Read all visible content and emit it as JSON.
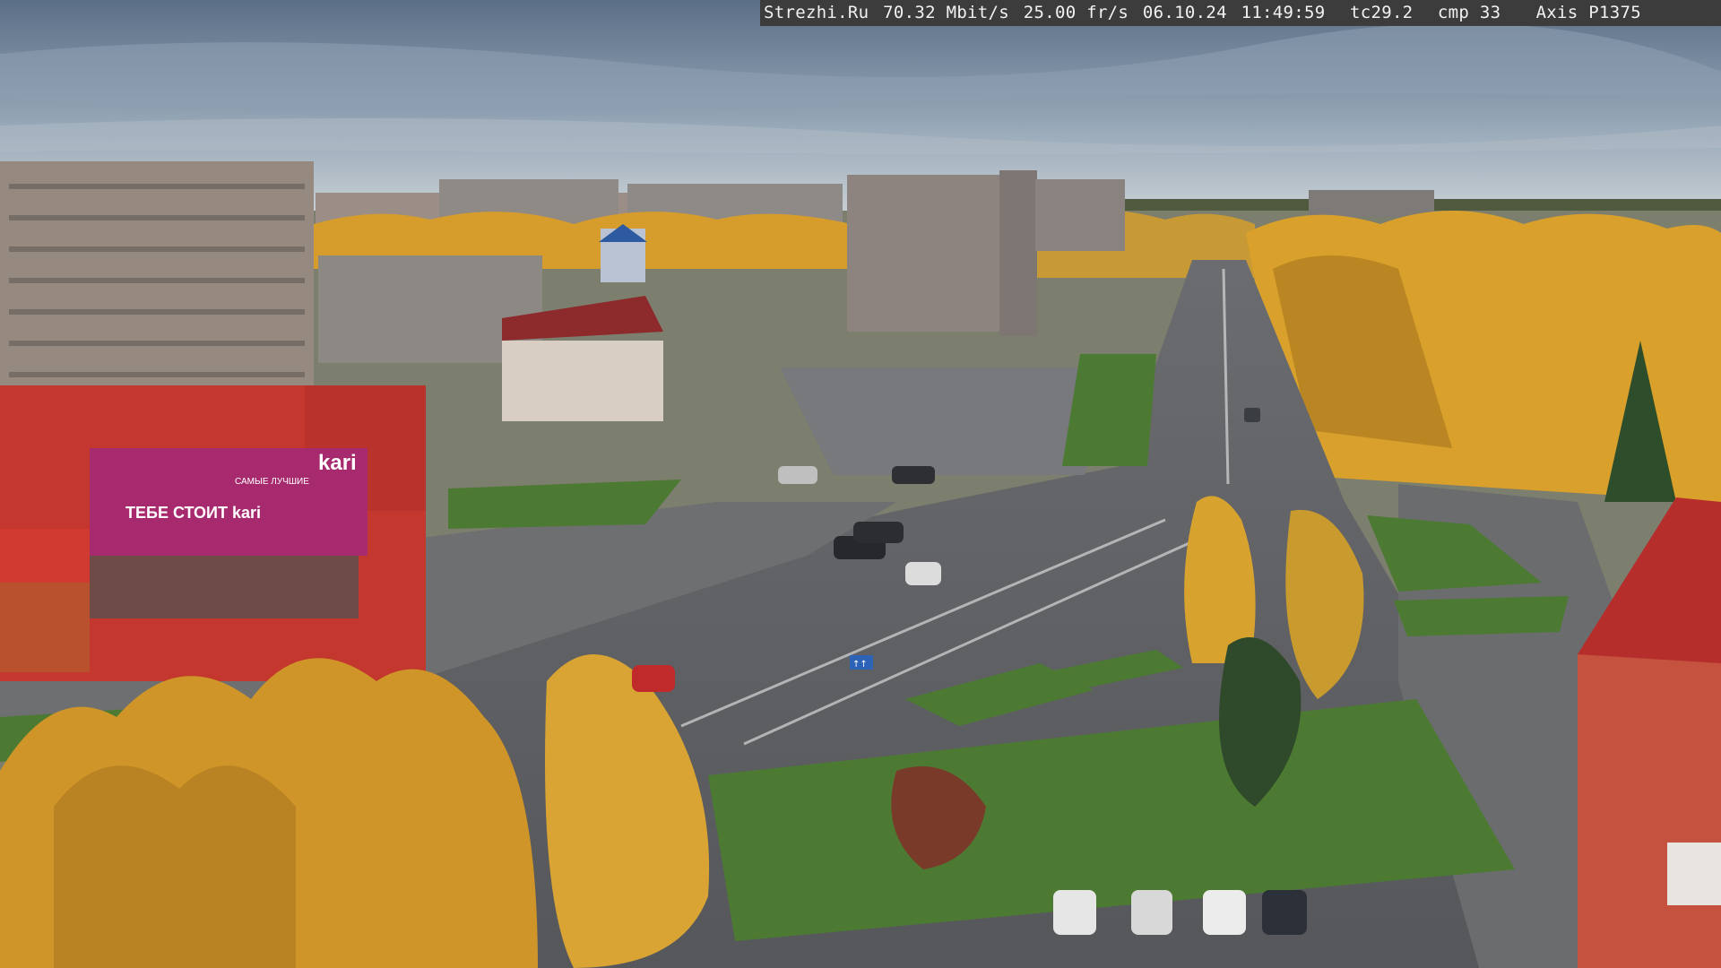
{
  "overlay": {
    "site": "Strezhi.Ru",
    "bitrate": "70.32 Mbit/s",
    "framerate": "25.00 fr/s",
    "date": "06.10.24",
    "time": "11:49:59",
    "tc": "tc29.2",
    "cmp": "cmp 33",
    "camera": "Axis P1375"
  },
  "signage": {
    "store_logo": "kari",
    "store_sign": "ТЕБЕ СТОИТ kari",
    "store_subsign": "САМЫЕ ЛУЧШИЕ",
    "road_sign": "↑↑"
  },
  "colors": {
    "sky_top": "#5c6f85",
    "sky_bottom": "#c3ccd1",
    "asphalt": "#5d5f63",
    "grass": "#4d7a33",
    "foliage": "#d39a2a",
    "store_red": "#c4372e",
    "store_magenta": "#a82a6e"
  }
}
